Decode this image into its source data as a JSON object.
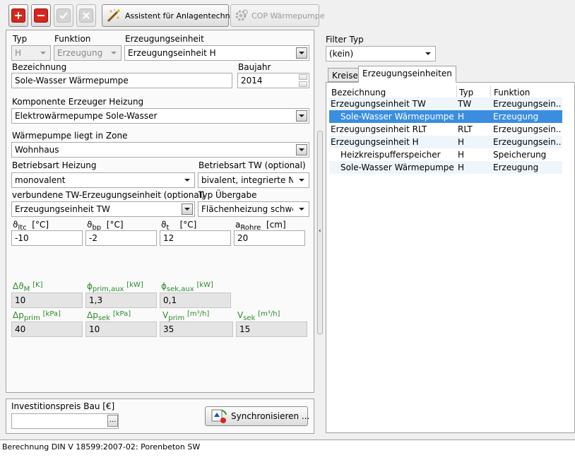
{
  "toolbar": {
    "add_icon": "plus-icon",
    "remove_icon": "minus-icon",
    "accept_icon": "check-icon",
    "cancel_icon": "x-icon",
    "assistant_label": "Assistent für Anlagentechnik",
    "cop_label": "COP Wärmepumpe"
  },
  "form": {
    "typ_label": "Typ",
    "typ_value": "H",
    "funktion_label": "Funktion",
    "funktion_value": "Erzeugung g",
    "erzeugungseinheit_label": "Erzeugungseinheit",
    "erzeugungseinheit_value": "Erzeugungseinheit H",
    "bezeichnung_label": "Bezeichnung",
    "bezeichnung_value": "Sole-Wasser Wärmepumpe",
    "baujahr_label": "Baujahr",
    "baujahr_value": "2014",
    "komponente_label": "Komponente Erzeuger Heizung",
    "komponente_value": "Elektrowärmepumpe Sole-Wasser",
    "zone_label": "Wärmepumpe liegt in Zone",
    "zone_value": "Wohnhaus",
    "betriebsart_heizung_label": "Betriebsart Heizung",
    "betriebsart_heizung_value": "monovalent",
    "betriebsart_tw_label": "Betriebsart TW (optional)",
    "betriebsart_tw_value": "bivalent, integrierte Nac",
    "tw_einheit_label": "verbundene TW-Erzeugungseinheit (optional)",
    "tw_einheit_value": "Erzeugungseinheit TW",
    "uebergabe_label": "Typ Übergabe",
    "uebergabe_value": "Flächenheizung schwer",
    "temps": [
      {
        "sym": "ϑ",
        "sub": "ltc",
        "unit": "[°C]",
        "value": "-10"
      },
      {
        "sym": "ϑ",
        "sub": "bp",
        "unit": "[°C]",
        "value": "-2"
      },
      {
        "sym": "ϑ",
        "sub": "t",
        "unit": "[°C]",
        "value": "12"
      },
      {
        "sym": "a",
        "sub": "Rohre",
        "unit": "[cm]",
        "value": "20"
      }
    ],
    "calc_row1": [
      {
        "sym": "Δϑ",
        "sub": "M",
        "unit": "[K]",
        "value": "10"
      },
      {
        "sym": "ϕ",
        "sub": "prim,aux",
        "unit": "[kW]",
        "value": "1,3"
      },
      {
        "sym": "ϕ",
        "sub": "sek,aux",
        "unit": "[kW]",
        "value": "0,1"
      }
    ],
    "calc_row2": [
      {
        "sym": "Δp",
        "sub": "prim",
        "unit": "[kPa]",
        "value": "40"
      },
      {
        "sym": "Δp",
        "sub": "sek",
        "unit": "[kPa]",
        "value": "10"
      },
      {
        "sym": "V",
        "sub": "prim",
        "unit": "[m³/h]",
        "value": "35"
      },
      {
        "sym": "V",
        "sub": "sek",
        "unit": "[m³/h]",
        "value": "15"
      }
    ]
  },
  "invest": {
    "label": "Investitionspreis Bau [€]",
    "value": "",
    "browse_label": "...",
    "sync_label": "Synchronisieren ..."
  },
  "filter": {
    "label": "Filter Typ",
    "value": "(kein)"
  },
  "tabs": [
    {
      "label": "Kreise"
    },
    {
      "label": "Erzeugungseinheiten"
    }
  ],
  "table": {
    "headers": [
      "Bezeichnung",
      "Typ",
      "Funktion"
    ],
    "rows": [
      {
        "name": "Erzeugungseinheit TW",
        "typ": "TW",
        "funktion": "Erzeugungsein..."
      },
      {
        "name": "Sole-Wasser Wärmepumpe",
        "typ": "H",
        "funktion": "Erzeugung"
      },
      {
        "name": "Erzeugungseinheit RLT",
        "typ": "RLT",
        "funktion": "Erzeugungsein..."
      },
      {
        "name": "Erzeugungseinheit H",
        "typ": "H",
        "funktion": "Erzeugungsein..."
      },
      {
        "name": "Heizkreispufferspeicher",
        "typ": "H",
        "funktion": "Speicherung"
      },
      {
        "name": "Sole-Wasser Wärmepumpe",
        "typ": "H",
        "funktion": "Erzeugung"
      }
    ]
  },
  "status": {
    "text": "Berechnung DIN V 18599:2007-02: Porenbeton SW"
  },
  "colors": {
    "selection": "#3b8edf",
    "calc_label": "#2a8a2a",
    "add": "#d8261c"
  }
}
